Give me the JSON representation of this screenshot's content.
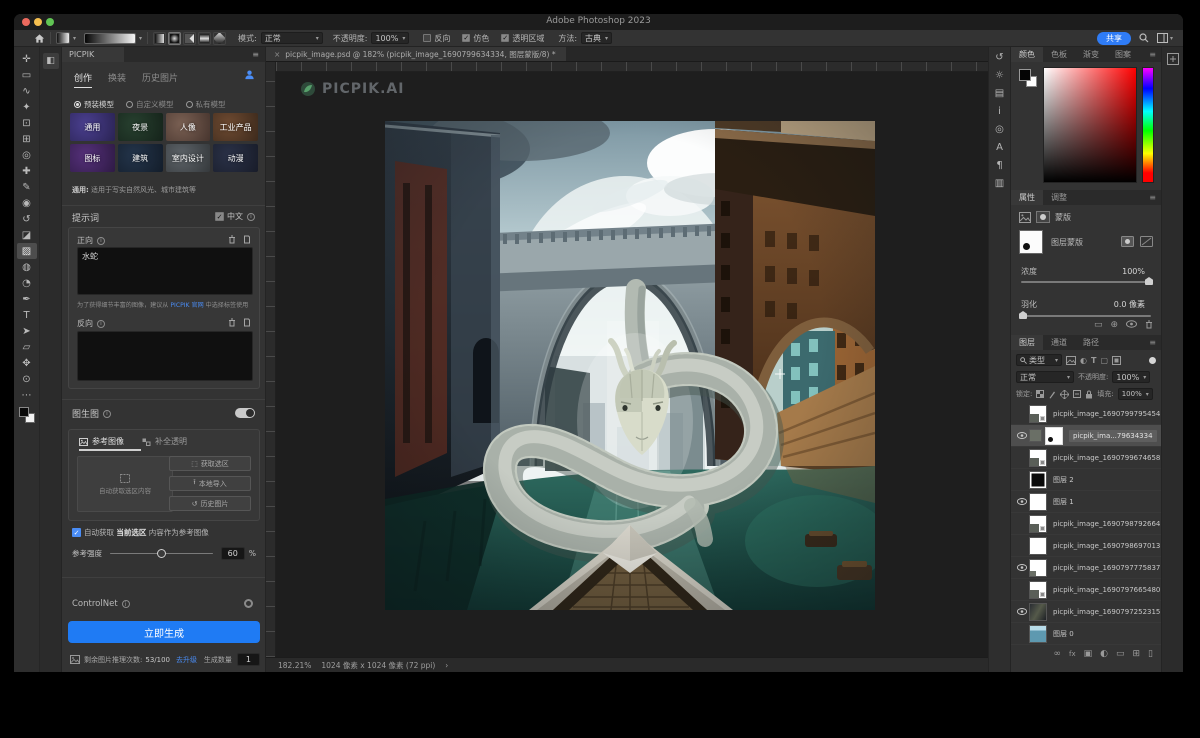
{
  "titlebar": {
    "title": "Adobe Photoshop 2023"
  },
  "options_bar": {
    "mode_label": "模式:",
    "mode_value": "正常",
    "opacity_label": "不透明度:",
    "opacity_value": "100%",
    "reverse_label": "反向",
    "dither_label": "仿色",
    "transparency_label": "透明区域",
    "method_label": "方法:",
    "method_value": "古典",
    "share_label": "共享",
    "gradient_types": [
      "linear-gradient-icon",
      "radial-gradient-icon",
      "angle-gradient-icon",
      "reflected-gradient-icon",
      "diamond-gradient-icon"
    ]
  },
  "toolbar": {
    "tools": [
      {
        "name": "move-tool",
        "glyph": "✛"
      },
      {
        "name": "marquee-tool",
        "glyph": "▭"
      },
      {
        "name": "lasso-tool",
        "glyph": "∿"
      },
      {
        "name": "magic-wand-tool",
        "glyph": "✦"
      },
      {
        "name": "crop-tool",
        "glyph": "⊡"
      },
      {
        "name": "frame-tool",
        "glyph": "⊞"
      },
      {
        "name": "eyedropper-tool",
        "glyph": "◎"
      },
      {
        "name": "healing-tool",
        "glyph": "✚"
      },
      {
        "name": "brush-tool",
        "glyph": "✎"
      },
      {
        "name": "stamp-tool",
        "glyph": "◉"
      },
      {
        "name": "history-brush-tool",
        "glyph": "↺"
      },
      {
        "name": "eraser-tool",
        "glyph": "◪"
      },
      {
        "name": "gradient-tool",
        "glyph": "▨",
        "selected": true
      },
      {
        "name": "blur-tool",
        "glyph": "◍"
      },
      {
        "name": "dodge-tool",
        "glyph": "◔"
      },
      {
        "name": "pen-tool",
        "glyph": "✒"
      },
      {
        "name": "type-tool",
        "glyph": "T"
      },
      {
        "name": "path-select-tool",
        "glyph": "➤"
      },
      {
        "name": "shape-tool",
        "glyph": "▱"
      },
      {
        "name": "hand-tool",
        "glyph": "✥"
      },
      {
        "name": "zoom-tool",
        "glyph": "⊙"
      },
      {
        "name": "more-tools",
        "glyph": "⋯"
      }
    ]
  },
  "right_strip": {
    "icons": [
      {
        "name": "history-panel-icon",
        "glyph": "↺"
      },
      {
        "name": "adjustments-panel-icon",
        "glyph": "☼"
      },
      {
        "name": "libraries-panel-icon",
        "glyph": "▤"
      },
      {
        "name": "info-panel-icon",
        "glyph": "i"
      },
      {
        "name": "navigator-panel-icon",
        "glyph": "◎"
      },
      {
        "name": "character-panel-icon",
        "glyph": "A"
      },
      {
        "name": "paragraph-panel-icon",
        "glyph": "¶"
      },
      {
        "name": "panel-icon",
        "glyph": "▥"
      }
    ]
  },
  "document": {
    "tab_close": "×",
    "tab_title": "picpik_image.psd @ 182% (picpik_image_1690799634334, 图层蒙版/8) *",
    "watermark": "PICPIK.AI",
    "status_zoom": "182.21%",
    "status_dims": "1024 像素 x 1024 像素 (72 ppi)",
    "status_caret": "›"
  },
  "picpik": {
    "panel_title": "PICPIK",
    "menu_glyph": "≡",
    "tabs": [
      "创作",
      "换装",
      "历史图片"
    ],
    "model_section": {
      "radio_selected": "预装模型",
      "radio_options": [
        "自定义模型",
        "私有模型"
      ],
      "models": [
        {
          "label": "通用",
          "c1": "#4a3f8f",
          "c2": "#2a2353"
        },
        {
          "label": "夜景",
          "c1": "#27402f",
          "c2": "#15231a"
        },
        {
          "label": "人像",
          "c1": "#7a6053",
          "c2": "#47352e"
        },
        {
          "label": "工业产品",
          "c1": "#6e4a31",
          "c2": "#3d2a1c"
        },
        {
          "label": "图标",
          "c1": "#55307a",
          "c2": "#2e1a44"
        },
        {
          "label": "建筑",
          "c1": "#23344a",
          "c2": "#131d2a"
        },
        {
          "label": "室内设计",
          "c1": "#5d6368",
          "c2": "#35393c"
        },
        {
          "label": "动漫",
          "c1": "#2a3147",
          "c2": "#181c29"
        }
      ],
      "description_prefix": "通用:",
      "description": "适用于写实自然风光、城市建筑等"
    },
    "prompt": {
      "section_title": "提示词",
      "lang_label": "中文",
      "positive_label": "正向",
      "positive_value": "水蛇",
      "hint_before": "为了获得细节丰富的图像，建议从",
      "hint_link": "PICPIK 官网",
      "hint_after": "中选择标签使用",
      "negative_label": "反向"
    },
    "img2img": {
      "section_title": "图生图",
      "tab_reference": "参考图像",
      "tab_transparent": "补全透明",
      "dropzone_text": "自动获取选区内容",
      "buttons": [
        "获取选区",
        "本地导入",
        "历史图片"
      ],
      "auto_prefix": "自动获取",
      "auto_highlight": "当前选区",
      "auto_suffix": "内容作为参考图像",
      "strength_label": "参考强度",
      "strength_value": "60",
      "strength_unit": "%"
    },
    "controlnet_label": "ControlNet",
    "generate_label": "立即生成",
    "footer": {
      "quota_label": "剩余图片推理次数:",
      "quota_value": "53/100",
      "upgrade_label": "去升级",
      "count_label": "生成数量",
      "count_value": "1"
    }
  },
  "color_panel": {
    "tabs": [
      "颜色",
      "色板",
      "渐变",
      "图案"
    ]
  },
  "properties_panel": {
    "tabs": [
      "属性",
      "调整"
    ],
    "mask_label": "蒙版",
    "thumb_label": "图层蒙版",
    "density_label": "浓度",
    "density_value": "100%",
    "feather_label": "羽化",
    "feather_value": "0.0 像素"
  },
  "layers_panel": {
    "tabs": [
      "图层",
      "通道",
      "路径"
    ],
    "filter_label": "类型",
    "blend_value": "正常",
    "opacity_label": "不透明度:",
    "opacity_value": "100%",
    "lock_label": "锁定:",
    "fill_label": "填充:",
    "fill_value": "100%",
    "layers": [
      {
        "name": "picpik_image_1690799795454",
        "eye": false,
        "selected": false,
        "thumb": "image"
      },
      {
        "name": "picpik_ima...79634334",
        "eye": true,
        "selected": true,
        "thumb": "mask"
      },
      {
        "name": "picpik_image_1690799674658",
        "eye": false,
        "selected": false,
        "thumb": "image"
      },
      {
        "name": "图层 2",
        "eye": false,
        "selected": false,
        "thumb": "black"
      },
      {
        "name": "图层 1",
        "eye": true,
        "selected": false,
        "thumb": "white"
      },
      {
        "name": "picpik_image_1690798792664",
        "eye": false,
        "selected": false,
        "thumb": "image"
      },
      {
        "name": "picpik_image_1690798697013",
        "eye": false,
        "selected": false,
        "thumb": "white"
      },
      {
        "name": "picpik_image_1690797775837",
        "eye": true,
        "selected": false,
        "thumb": "image2"
      },
      {
        "name": "picpik_image_1690797665480",
        "eye": false,
        "selected": false,
        "thumb": "image"
      },
      {
        "name": "picpik_image_1690797252315",
        "eye": true,
        "selected": false,
        "thumb": "photo"
      },
      {
        "name": "图层 0",
        "eye": false,
        "selected": false,
        "thumb": "blue"
      }
    ],
    "bottom_icons": [
      "link-icon",
      "fx-icon",
      "mask-icon",
      "adjustment-icon",
      "group-icon",
      "new-layer-icon",
      "delete-icon"
    ]
  }
}
